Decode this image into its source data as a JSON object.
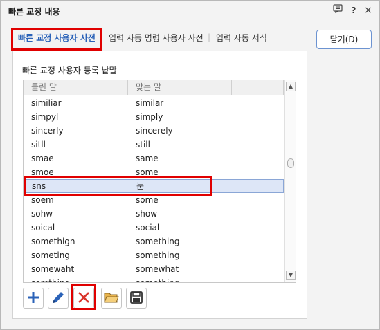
{
  "window": {
    "title": "빠른 교정 내용",
    "help_icon": "message-icon",
    "question_label": "?",
    "close_label": "×"
  },
  "tabs": [
    {
      "label": "빠른 교정 사용자 사전",
      "active": true
    },
    {
      "label": "입력 자동 명령 사용자 사전",
      "active": false
    },
    {
      "label": "입력 자동 서식",
      "active": false
    }
  ],
  "tab_separator": "|",
  "close_button_label": "닫기(D)",
  "section_label": "빠른 교정 사용자 등록 낱말",
  "list": {
    "columns": [
      "틀린 말",
      "맞는 말",
      ""
    ],
    "rows": [
      {
        "wrong": "similiar",
        "right": "similar"
      },
      {
        "wrong": "simpyl",
        "right": "simply"
      },
      {
        "wrong": "sincerly",
        "right": "sincerely"
      },
      {
        "wrong": "sitll",
        "right": "still"
      },
      {
        "wrong": "smae",
        "right": "same"
      },
      {
        "wrong": "smoe",
        "right": "some"
      },
      {
        "wrong": "sns",
        "right": "눈",
        "selected": true
      },
      {
        "wrong": "soem",
        "right": "some"
      },
      {
        "wrong": "sohw",
        "right": "show"
      },
      {
        "wrong": "soical",
        "right": "social"
      },
      {
        "wrong": "somethign",
        "right": "something"
      },
      {
        "wrong": "someting",
        "right": "something"
      },
      {
        "wrong": "somewaht",
        "right": "somewhat"
      },
      {
        "wrong": "somthing",
        "right": "something"
      }
    ]
  },
  "toolbar": {
    "add_icon": "plus-icon",
    "edit_icon": "pencil-icon",
    "delete_icon": "x-icon",
    "open_icon": "folder-icon",
    "save_icon": "floppy-disk-icon"
  },
  "colors": {
    "accent": "#2a62b8",
    "highlight": "#e00000",
    "selected_row": "#dde6f7",
    "delete": "#d9342b"
  }
}
